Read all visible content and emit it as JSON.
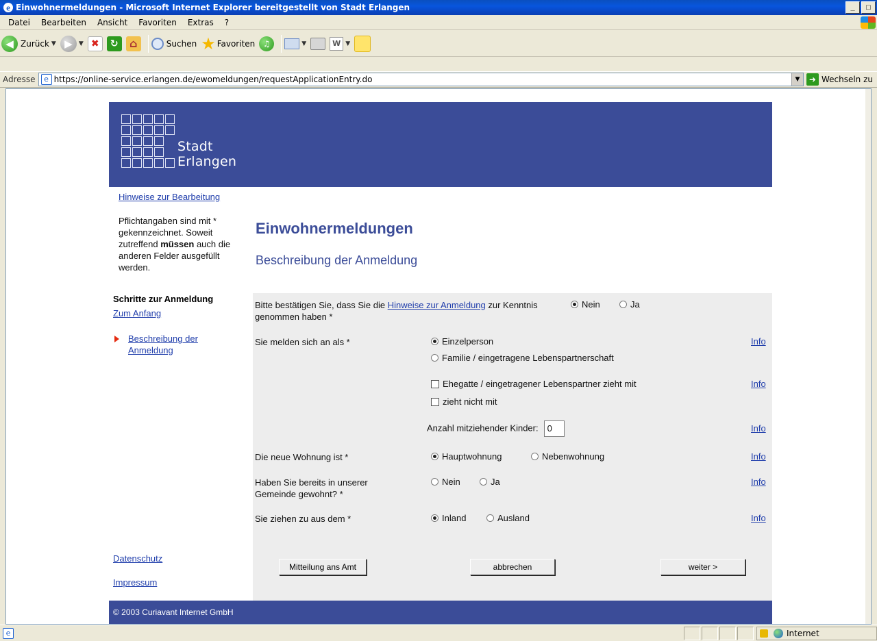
{
  "window": {
    "title": "Einwohnermeldungen - Microsoft Internet Explorer bereitgestellt von Stadt Erlangen",
    "min_label": "_",
    "max_label": "□"
  },
  "menubar": {
    "items": [
      "Datei",
      "Bearbeiten",
      "Ansicht",
      "Favoriten",
      "Extras",
      "?"
    ]
  },
  "toolbar": {
    "back_label": "Zurück",
    "search_label": "Suchen",
    "favorites_label": "Favoriten"
  },
  "address": {
    "label": "Adresse",
    "url": "https://online-service.erlangen.de/ewomeldungen/requestApplicationEntry.do",
    "go_label": "Wechseln zu"
  },
  "logo": {
    "line1": "Stadt",
    "line2": "Erlangen"
  },
  "sidebar": {
    "hints_link": "Hinweise zur Bearbeitung",
    "hint_text_1": "Pflichtangaben sind mit * gekennzeichnet. Soweit zutreffend ",
    "hint_text_bold": "müssen",
    "hint_text_2": " auch die anderen Felder ausgefüllt werden.",
    "steps_heading": "Schritte zur Anmeldung",
    "start_link": "Zum Anfang",
    "current_step_line1": "Beschreibung der",
    "current_step_line2": "Anmeldung",
    "privacy_link": "Datenschutz",
    "imprint_link": "Impressum"
  },
  "main": {
    "title": "Einwohnermeldungen",
    "subtitle": "Beschreibung der Anmeldung"
  },
  "form": {
    "confirm_q_pre": "Bitte bestätigen Sie, dass Sie die ",
    "confirm_q_link": "Hinweise zur Anmeldung",
    "confirm_q_post": " zur Kenntnis genommen haben *",
    "no_label": "Nein",
    "yes_label": "Ja",
    "register_as_q": "Sie melden sich an als *",
    "single_person": "Einzelperson",
    "family": "Familie / eingetragene Lebenspartnerschaft",
    "spouse_moves": "Ehegatte / eingetragener Lebenspartner zieht mit",
    "not_moving": "zieht nicht mit",
    "children_label": "Anzahl mitziehender Kinder:",
    "children_value": "0",
    "new_flat_q": "Die neue Wohnung ist *",
    "main_residence": "Hauptwohnung",
    "secondary_residence": "Nebenwohnung",
    "lived_before_q": "Haben Sie bereits in unserer Gemeinde gewohnt? *",
    "moving_from_q": "Sie ziehen zu aus dem *",
    "domestic": "Inland",
    "abroad": "Ausland",
    "info_label": "Info",
    "confirm_selected": "Nein",
    "register_selected": "Einzelperson",
    "residence_selected": "Hauptwohnung",
    "origin_selected": "Inland"
  },
  "buttons": {
    "notify": "Mitteilung ans Amt",
    "cancel": "abbrechen",
    "next": "weiter >"
  },
  "footer": {
    "copyright": "© 2003 Curiavant Internet GmbH"
  },
  "statusbar": {
    "zone": "Internet"
  }
}
